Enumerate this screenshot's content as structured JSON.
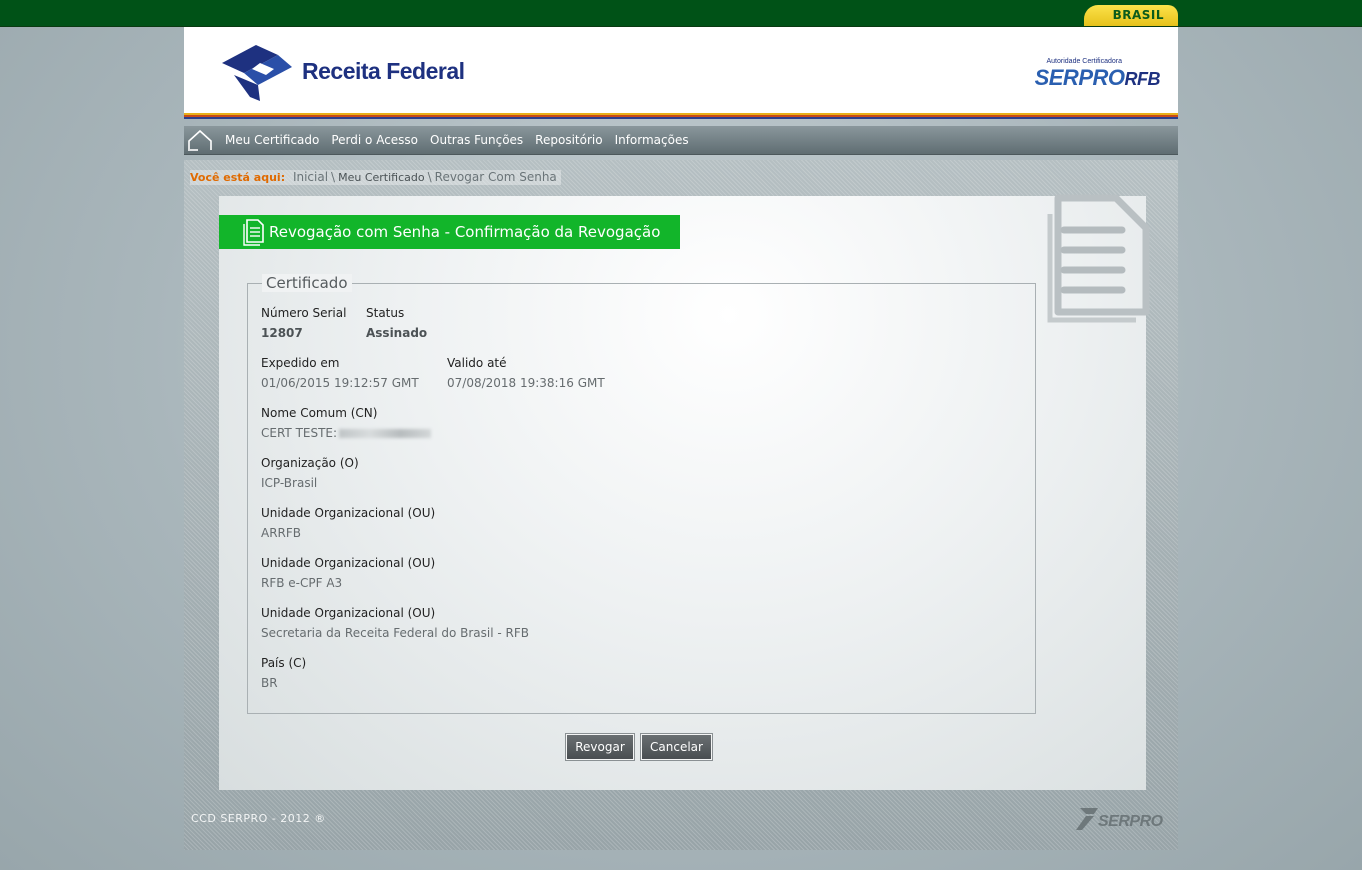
{
  "gov_bar": {
    "brasil_label": "BRASIL"
  },
  "header": {
    "logo_text": "Receita Federal",
    "serpro_caption": "Autoridade Certificadora",
    "serpro_name": "SERPRO",
    "serpro_suffix": "RFB"
  },
  "nav": {
    "items": [
      "Meu Certificado",
      "Perdi o Acesso",
      "Outras Funções",
      "Repositório",
      "Informações"
    ]
  },
  "breadcrumb": {
    "label": "Você está aqui:",
    "items": [
      "Inicial",
      "Meu Certificado",
      "Revogar Com Senha"
    ]
  },
  "title": "Revogação com Senha - Confirmação da Revogação",
  "certificate": {
    "legend": "Certificado",
    "serial_label": "Número Serial",
    "serial_value": "12807",
    "status_label": "Status",
    "status_value": "Assinado",
    "issued_label": "Expedido em",
    "issued_value": "01/06/2015 19:12:57 GMT",
    "valid_label": "Valido até",
    "valid_value": "07/08/2018 19:38:16 GMT",
    "cn_label": "Nome Comum (CN)",
    "cn_value": "CERT TESTE:",
    "o_label": "Organização (O)",
    "o_value": "ICP-Brasil",
    "ou1_label": "Unidade Organizacional (OU)",
    "ou1_value": "ARRFB",
    "ou2_label": "Unidade Organizacional (OU)",
    "ou2_value": "RFB e-CPF A3",
    "ou3_label": "Unidade Organizacional (OU)",
    "ou3_value": "Secretaria da Receita Federal do Brasil - RFB",
    "c_label": "País (C)",
    "c_value": "BR"
  },
  "buttons": {
    "revoke": "Revogar",
    "cancel": "Cancelar"
  },
  "footer": {
    "copyright": "CCD SERPRO - 2012 ®",
    "logo": "SERPRO"
  },
  "colors": {
    "gov_green": "#005217",
    "title_green": "#12b52a",
    "accent_orange": "#e06a00",
    "brand_blue": "#1e3180"
  }
}
